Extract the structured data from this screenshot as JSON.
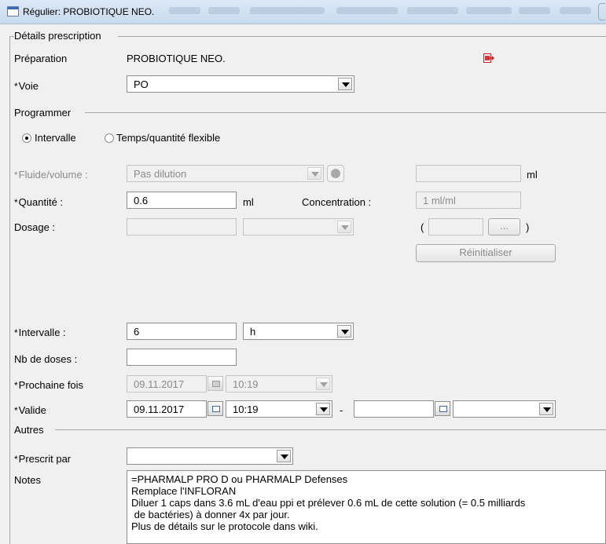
{
  "window": {
    "title": "Régulier: PROBIOTIQUE NEO."
  },
  "section_details": "Détails prescription",
  "preparation": {
    "label": "Préparation",
    "value": "PROBIOTIQUE NEO."
  },
  "voie": {
    "star": "*",
    "label": "Voie",
    "value": "PO"
  },
  "section_programmer": "Programmer",
  "schedule": {
    "option_interval": "Intervalle",
    "option_flexible": "Temps/quantité flexible",
    "selected": "Intervalle"
  },
  "fluide": {
    "star": "*",
    "label": "Fluide/volume :",
    "value": "Pas dilution",
    "volume_value": "",
    "unit": "ml"
  },
  "quantite": {
    "star": "*",
    "label": "Quantité :",
    "value": "0.6",
    "unit": "ml"
  },
  "concentration": {
    "label": "Concentration :",
    "value": "1 ml/ml"
  },
  "dosage": {
    "label": "Dosage :",
    "value": "",
    "unit": "",
    "paren_open": "(",
    "paren_close": ")",
    "more_label": "..."
  },
  "reset_button": "Réinitialiser",
  "intervalle": {
    "star": "*",
    "label": "Intervalle :",
    "value": "6",
    "unit": "h"
  },
  "nb_doses": {
    "label": "Nb de doses :",
    "value": ""
  },
  "prochaine": {
    "star": "*",
    "label": "Prochaine fois",
    "date": "09.11.2017",
    "time": "10:19"
  },
  "valide": {
    "star": "*",
    "label": "Valide",
    "date_from": "09.11.2017",
    "time_from": "10:19",
    "dash": "-",
    "date_to": "",
    "time_to": ""
  },
  "section_autres": "Autres",
  "prescrit": {
    "star": "*",
    "label": "Prescrit par",
    "value": ""
  },
  "notes": {
    "label": "Notes",
    "text": "=PHARMALP PRO D ou PHARMALP Defenses\nRemplace l'INFLORAN\nDiluer 1 caps dans 3.6 mL d'eau ppi et prélever 0.6 mL de cette solution (= 0.5 milliards\n de bactéries) à donner 4x par jour.\nPlus de détails sur le protocole dans wiki."
  }
}
